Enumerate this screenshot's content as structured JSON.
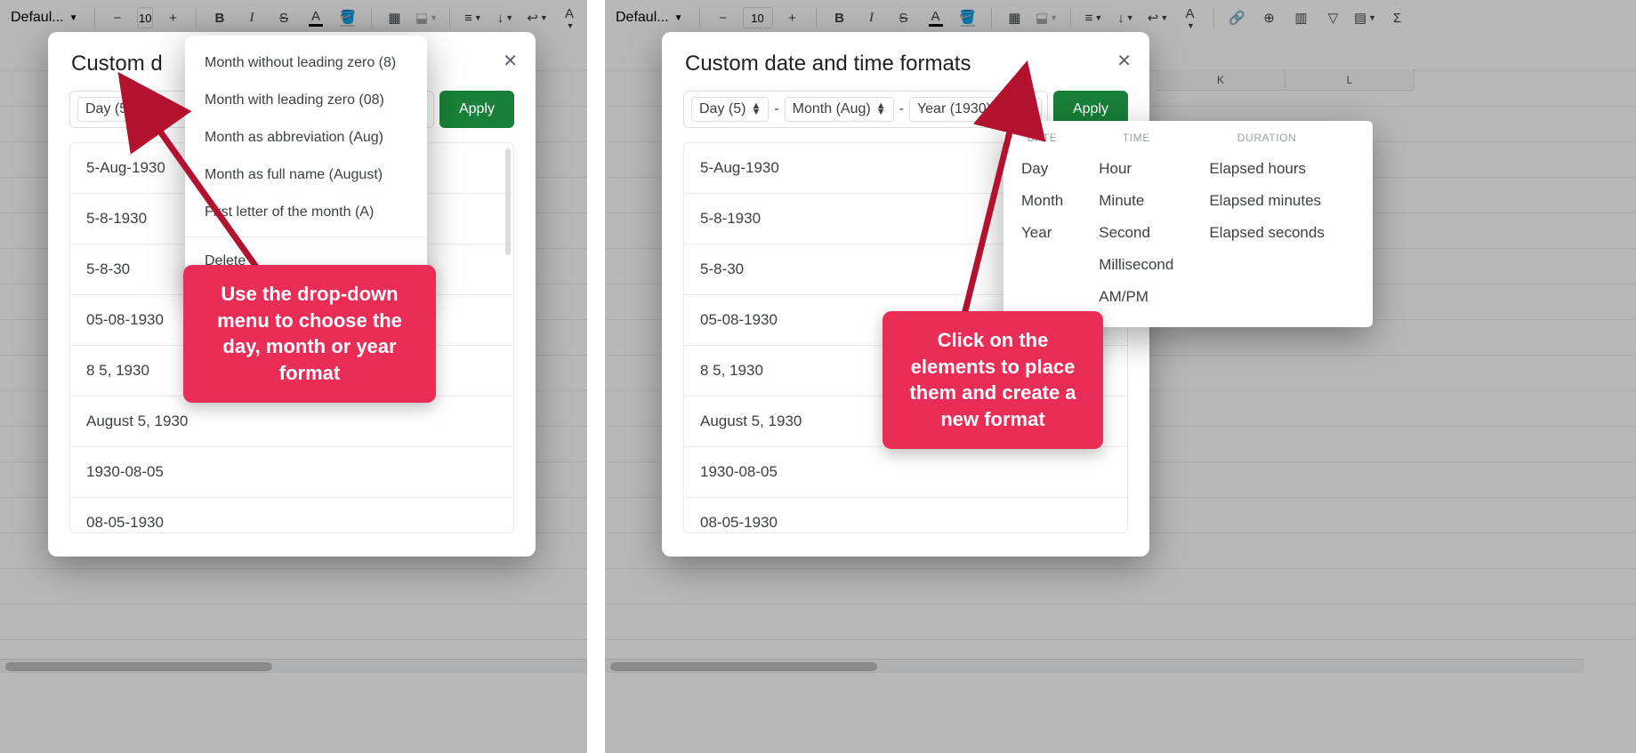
{
  "toolbar": {
    "font_label": "Defaul...",
    "font_size": "10",
    "bold": "B",
    "italic": "I",
    "strike": "S",
    "textcolor_letter": "A",
    "fill_letter": "A"
  },
  "dialog": {
    "title_full": "Custom date and time formats",
    "title_left_visible": "Custom d",
    "apply_label": "Apply",
    "chips": {
      "day": "Day (5)",
      "month": "Month (Aug)",
      "year": "Year (1930)"
    },
    "samples": [
      "5-Aug-1930",
      "5-8-1930",
      "5-8-30",
      "05-08-1930",
      "8 5, 1930",
      "August 5, 1930",
      "1930-08-05",
      "08-05-1930"
    ]
  },
  "month_menu": {
    "items": [
      "Month without leading zero (8)",
      "Month with leading zero (08)",
      "Month as abbreviation (Aug)",
      "Month as full name (August)",
      "First letter of the month (A)"
    ],
    "delete": "Delete"
  },
  "elem_menu": {
    "date_header": "DATE",
    "time_header": "TIME",
    "duration_header": "DURATION",
    "date_opts": [
      "Day",
      "Month",
      "Year"
    ],
    "time_opts": [
      "Hour",
      "Minute",
      "Second",
      "Millisecond",
      "AM/PM"
    ],
    "duration_opts": [
      "Elapsed hours",
      "Elapsed minutes",
      "Elapsed seconds"
    ]
  },
  "columns_right": [
    "K",
    "L"
  ],
  "callouts": {
    "left": "Use the drop-down menu to choose the day, month or year format",
    "right": "Click on the elements to place them and create a new format"
  }
}
